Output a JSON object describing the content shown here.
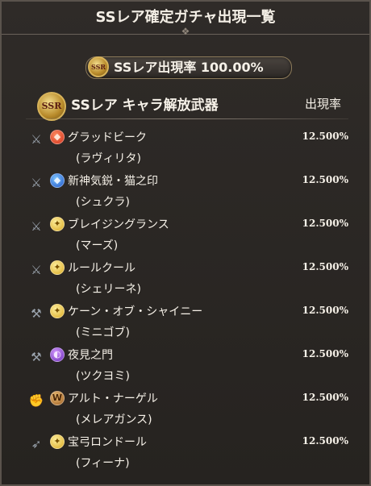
{
  "header": {
    "title": "SSレア確定ガチャ出現一覧"
  },
  "rate_summary": {
    "badge": "SSR",
    "text": "SSレア出現率 100.00%"
  },
  "category": {
    "badge": "SSR",
    "title": "SSレア キャラ解放武器",
    "rate_column": "出現率"
  },
  "items": [
    {
      "weapon_icon": "spear-icon",
      "element_icon": "fire-element-icon",
      "name": "グラッドビーク",
      "character": "(ラヴィリタ)",
      "rate": "12.500%"
    },
    {
      "weapon_icon": "sword-icon",
      "element_icon": "water-element-icon",
      "name": "新神気鋭・猫之印",
      "character": "(シュクラ)",
      "rate": "12.500%"
    },
    {
      "weapon_icon": "sword-icon",
      "element_icon": "light-element-icon",
      "name": "ブレイジングランス",
      "character": "(マーズ)",
      "rate": "12.500%"
    },
    {
      "weapon_icon": "sword-icon",
      "element_icon": "light-element-icon",
      "name": "ルールクール",
      "character": "(シェリーネ)",
      "rate": "12.500%"
    },
    {
      "weapon_icon": "axe-icon",
      "element_icon": "light-element-icon",
      "name": "ケーン・オブ・シャイニー",
      "character": "(ミニゴブ)",
      "rate": "12.500%"
    },
    {
      "weapon_icon": "axe-icon",
      "element_icon": "dark-element-icon",
      "name": "夜見之門",
      "character": "(ツクヨミ)",
      "rate": "12.500%"
    },
    {
      "weapon_icon": "gauntlet-icon",
      "element_icon": "earth-element-icon",
      "name": "アルト・ナーゲル",
      "character": "(メレアガンス)",
      "rate": "12.500%"
    },
    {
      "weapon_icon": "bow-icon",
      "element_icon": "light-element-icon",
      "name": "宝弓ロンドール",
      "character": "(フィーナ)",
      "rate": "12.500%"
    }
  ]
}
